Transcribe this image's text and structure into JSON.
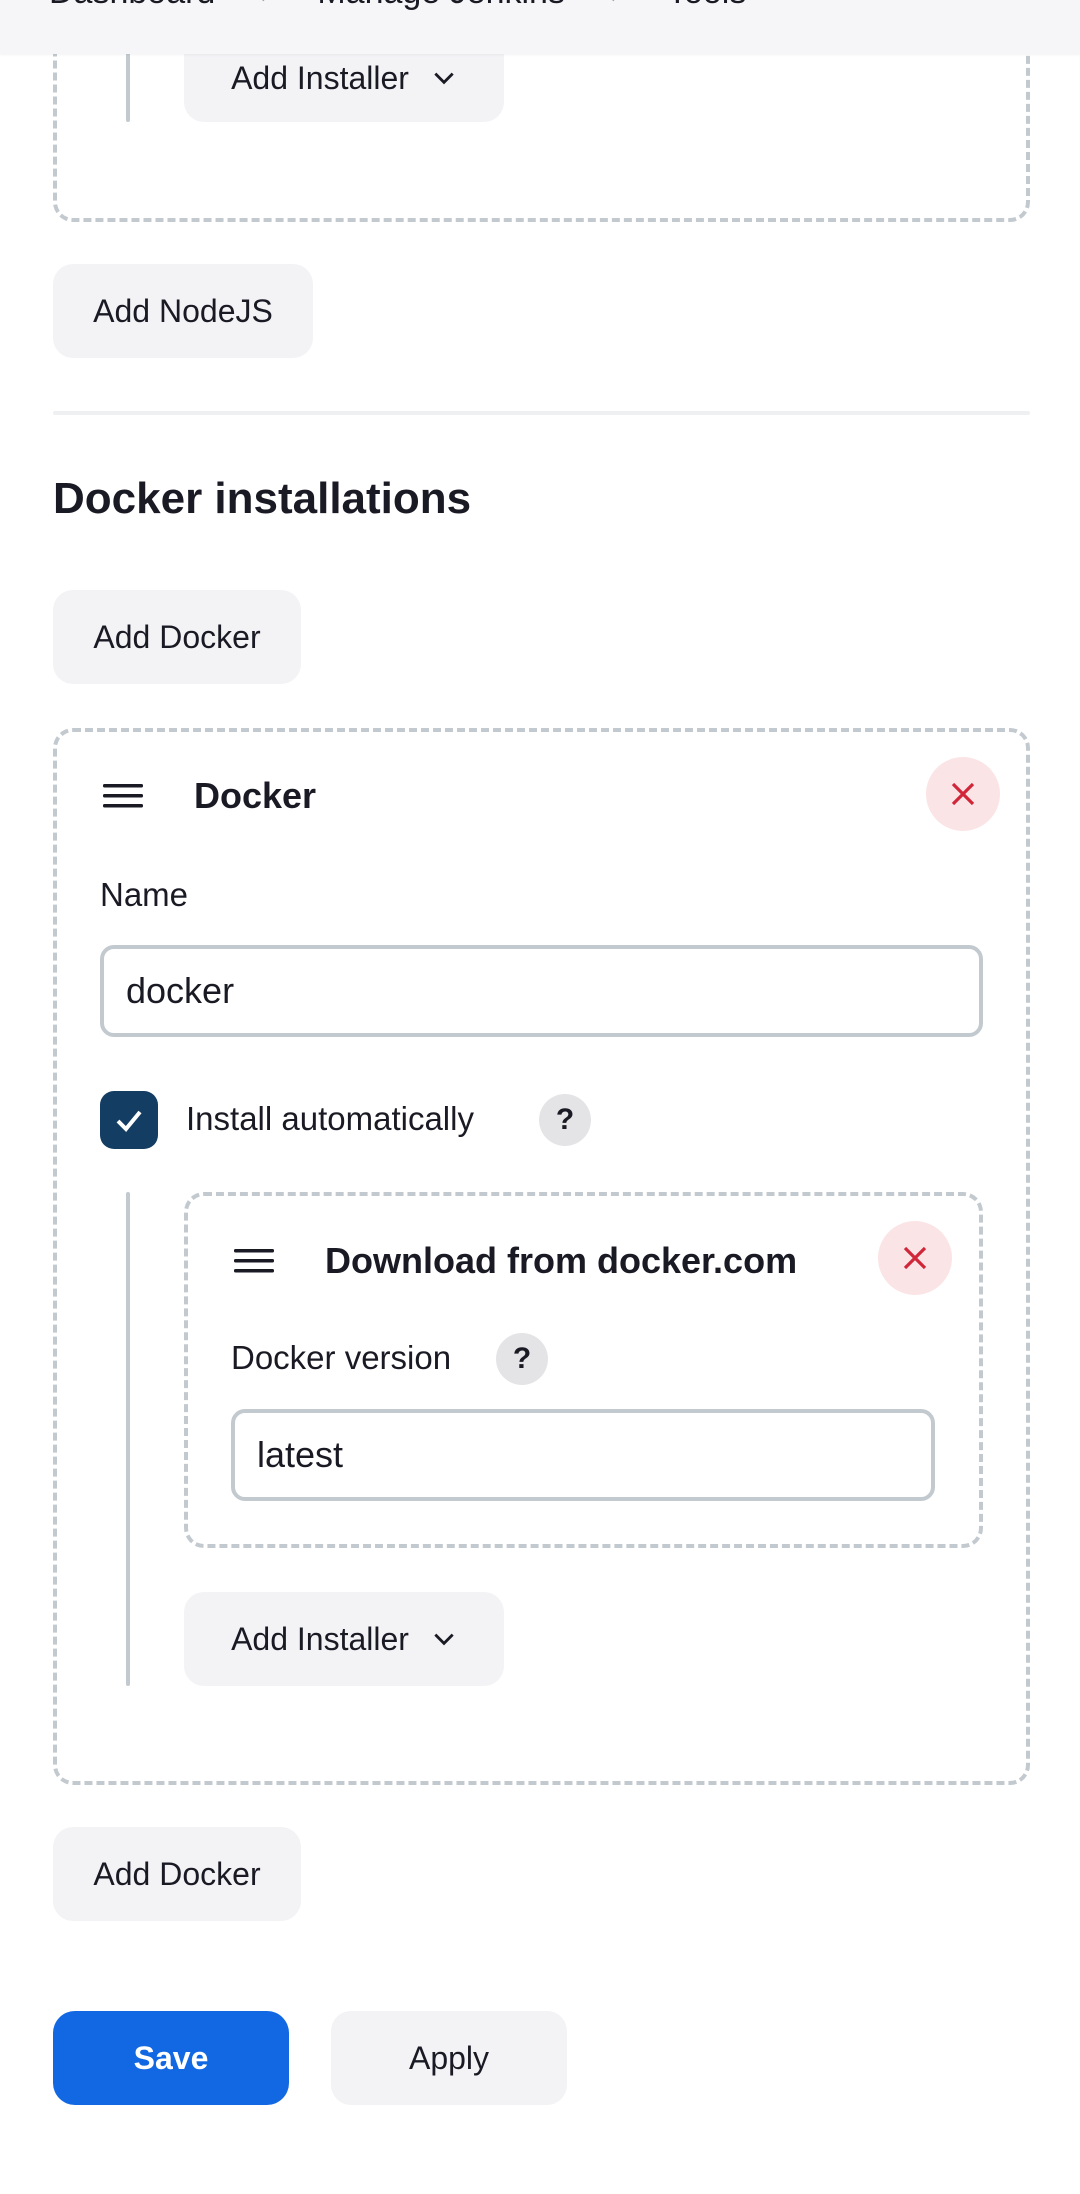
{
  "breadcrumb": {
    "items": [
      "Dashboard",
      "Manage Jenkins",
      "Tools"
    ]
  },
  "nodejs_section": {
    "add_installer_label": "Add Installer",
    "add_nodejs_label": "Add NodeJS"
  },
  "docker_section": {
    "heading": "Docker installations",
    "add_docker_top_label": "Add Docker",
    "tool": {
      "title": "Docker",
      "name_label": "Name",
      "name_value": "docker",
      "install_automatically_label": "Install automatically",
      "install_automatically_checked": true,
      "installer": {
        "title": "Download from docker.com",
        "version_label": "Docker version",
        "version_value": "latest"
      },
      "add_installer_label": "Add Installer"
    },
    "add_docker_bottom_label": "Add Docker"
  },
  "actions": {
    "save_label": "Save",
    "apply_label": "Apply"
  },
  "colors": {
    "primary": "#1168e2",
    "checkbox": "#143d63",
    "danger_bg": "#fbe4e6",
    "danger_icon": "#d1263a"
  },
  "icons": [
    "chevron-right-icon",
    "chevron-down-icon",
    "drag-handle-icon",
    "close-icon",
    "help-icon",
    "check-icon"
  ]
}
